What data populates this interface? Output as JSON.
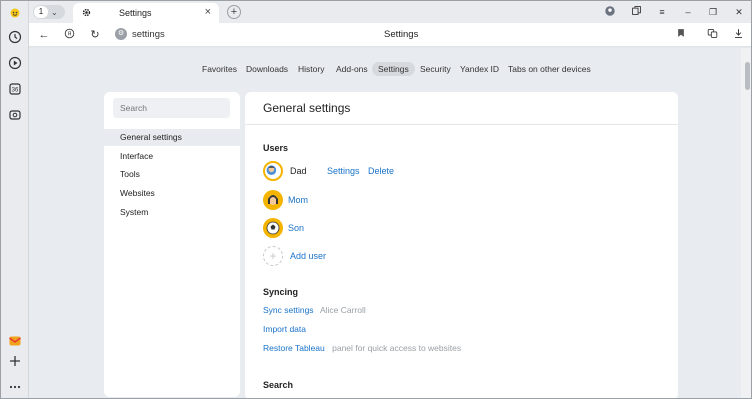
{
  "left_strip": {
    "icons": [
      "sun-face-icon",
      "history-icon",
      "play-icon",
      "extension-icon",
      "screenshot-icon",
      "mail-icon",
      "plus-icon",
      "more-icon"
    ]
  },
  "tabbar": {
    "tab_count": "1",
    "active_tab_title": "Settings"
  },
  "addrbar": {
    "url": "settings",
    "page_title": "Settings"
  },
  "topnav": {
    "items": [
      "Favorites",
      "Downloads",
      "History",
      "Add-ons",
      "Settings",
      "Security",
      "Yandex ID",
      "Tabs on other devices"
    ],
    "active": "Settings"
  },
  "sidebar": {
    "search_placeholder": "Search",
    "items": [
      "General settings",
      "Interface",
      "Tools",
      "Websites",
      "System"
    ],
    "active": "General settings"
  },
  "main": {
    "title": "General settings",
    "users": {
      "heading": "Users",
      "list": [
        {
          "name": "Dad",
          "settings_label": "Settings",
          "delete_label": "Delete"
        },
        {
          "name": "Mom"
        },
        {
          "name": "Son"
        }
      ],
      "add_label": "Add user"
    },
    "syncing": {
      "heading": "Syncing",
      "sync_settings_label": "Sync settings",
      "account_name": "Alice Carroll",
      "import_label": "Import data",
      "restore_label": "Restore Tableau",
      "restore_hint": "panel for quick access to websites"
    },
    "search": {
      "heading": "Search"
    }
  },
  "colors": {
    "link": "#1a73c9",
    "accent_yellow": "#f5b400",
    "page_bg": "#e8ebf0"
  }
}
